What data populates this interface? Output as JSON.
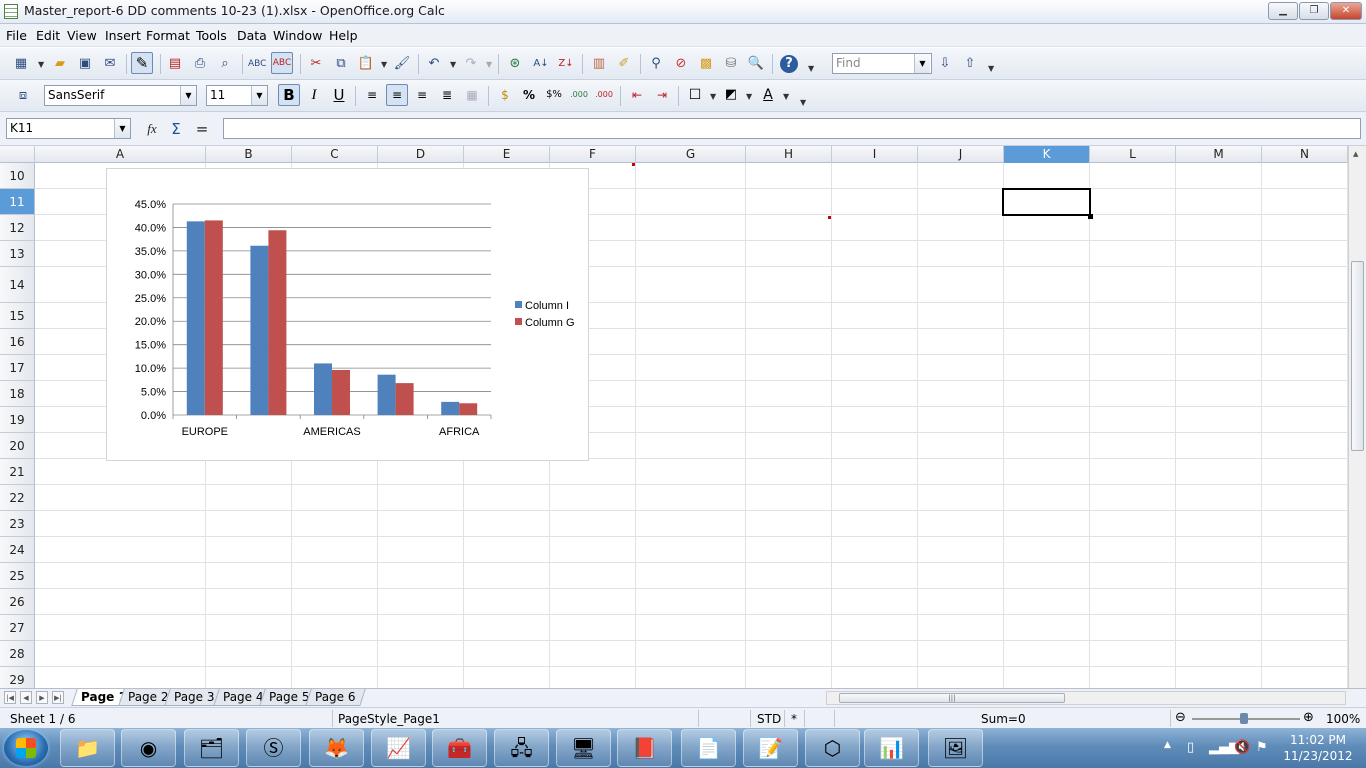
{
  "window": {
    "title": "Master_report-6 DD comments 10-23 (1).xlsx - OpenOffice.org Calc"
  },
  "menu": [
    "File",
    "Edit",
    "View",
    "Insert",
    "Format",
    "Tools",
    "Data",
    "Window",
    "Help"
  ],
  "toolbar": {
    "find_placeholder": "Find",
    "font_name": "SansSerif",
    "font_size": "11"
  },
  "formula": {
    "name_box": "K11",
    "content": ""
  },
  "columns": [
    "A",
    "B",
    "C",
    "D",
    "E",
    "F",
    "G",
    "H",
    "I",
    "J",
    "K",
    "L",
    "M",
    "N"
  ],
  "rows": [
    "10",
    "11",
    "12",
    "13",
    "14",
    "15",
    "16",
    "17",
    "18",
    "19",
    "20",
    "21",
    "22",
    "23",
    "24",
    "25",
    "26",
    "27",
    "28",
    "29"
  ],
  "selected": {
    "column": "K",
    "row": "11"
  },
  "chart_data": {
    "type": "bar",
    "categories": [
      "EUROPE",
      "",
      "AMERICAS",
      "",
      "AFRICA"
    ],
    "series": [
      {
        "name": "Column I",
        "values": [
          41.3,
          36.1,
          11.0,
          8.6,
          2.8
        ],
        "color": "#4f81bd"
      },
      {
        "name": "Column G",
        "values": [
          41.5,
          39.4,
          9.6,
          6.8,
          2.5
        ],
        "color": "#c0504d"
      }
    ],
    "yticks": [
      "0.0%",
      "5.0%",
      "10.0%",
      "15.0%",
      "20.0%",
      "25.0%",
      "30.0%",
      "35.0%",
      "40.0%",
      "45.0%"
    ],
    "ylim": [
      0,
      45
    ],
    "grid": true,
    "legend": "right",
    "title": "",
    "xlabel": "",
    "ylabel": ""
  },
  "sheets": [
    "Page 1",
    "Page 2",
    "Page 3",
    "Page 4",
    "Page 5",
    "Page 6"
  ],
  "active_sheet": "Page 1",
  "status": {
    "sheet": "Sheet 1 / 6",
    "page_style": "PageStyle_Page1",
    "mode": "STD",
    "modified": "*",
    "sum": "Sum=0",
    "zoom": "100%"
  },
  "clock": {
    "time": "11:02 PM",
    "date": "11/23/2012"
  },
  "icons": {
    "function": "fx",
    "sum": "Σ",
    "equals": "="
  }
}
